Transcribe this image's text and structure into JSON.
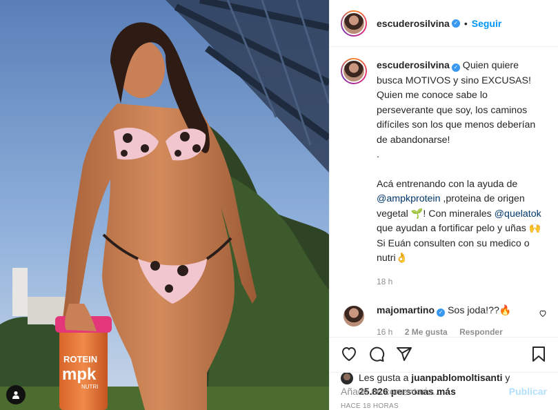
{
  "header": {
    "username": "escuderosilvina",
    "dot": "•",
    "follow_label": "Seguir"
  },
  "caption": {
    "username": "escuderosilvina",
    "lines": [
      "Quien quiere busca MOTIVOS y sino EXCUSAS! Quien me conoce sabe lo perseverante que soy, los caminos difíciles son los que menos deberían de abandonarse!",
      "."
    ],
    "p2_prefix": "Acá entrenando con la ayuda de ",
    "mention1": "@ampkprotein",
    "p2_mid": " ,proteina de origen vegetal 🌱! Con minerales ",
    "mention2": "@quelatok",
    "p2_suffix": " que ayudan a fortificar pelo y uñas 🙌 Si Euán consulten con su medico o nutri👌",
    "time": "18 h"
  },
  "comment": {
    "username": "majomartino",
    "text": "Sos joda!??🔥",
    "time": "16 h",
    "likes": "2 Me gusta",
    "reply": "Responder"
  },
  "likes": {
    "prefix": "Les gusta a ",
    "user": "juanpablomoltisanti",
    "and": " y",
    "count": "25.826 personas más"
  },
  "ago": "HACE 18 HORAS",
  "add_comment": {
    "placeholder": "Añade un comentario...",
    "publish": "Publicar"
  },
  "shaker": {
    "line1": "ROTEIN",
    "line2": "mpk",
    "line3": "NUTRI"
  },
  "icons": {
    "like": "heart-icon",
    "comment": "comment-icon",
    "share": "share-icon",
    "save": "bookmark-icon",
    "tag": "user-tag-icon"
  }
}
